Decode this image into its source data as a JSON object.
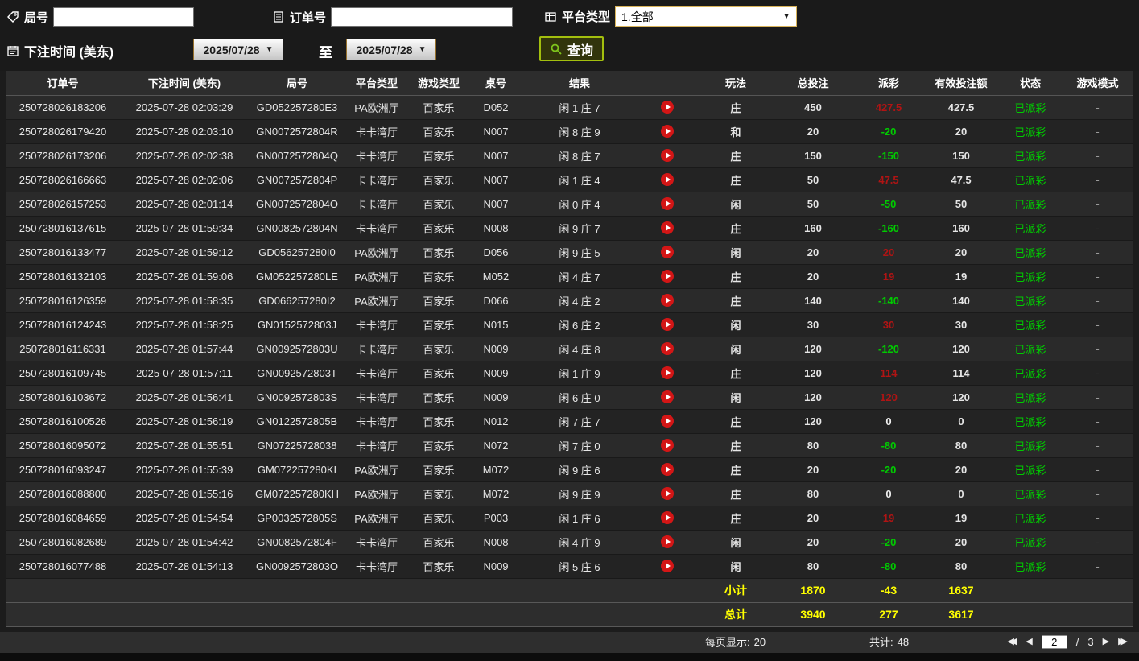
{
  "filters": {
    "game_no": {
      "label": "局号",
      "value": ""
    },
    "order_no": {
      "label": "订单号",
      "value": ""
    },
    "platform": {
      "label": "平台类型",
      "selected": "1.全部"
    },
    "bet_time": {
      "label": "下注时间 (美东)",
      "from": "2025/07/28",
      "to": "2025/07/28",
      "to_word": "至"
    },
    "query": {
      "label": "查询"
    }
  },
  "table": {
    "headers": [
      "订单号",
      "下注时间 (美东)",
      "局号",
      "平台类型",
      "游戏类型",
      "桌号",
      "结果",
      "",
      "玩法",
      "总投注",
      "派彩",
      "有效投注额",
      "状态",
      "游戏模式"
    ],
    "rows": [
      {
        "order": "250728026183206",
        "time": "2025-07-28 02:03:29",
        "game_no": "GD052257280E3",
        "platform": "PA欧洲厅",
        "game_type": "百家乐",
        "table_no": "D052",
        "result": "闲 1 庄 7",
        "side": "庄",
        "total_bet": "450",
        "payout": "427.5",
        "payout_color": "red",
        "valid_bet": "427.5",
        "status": "已派彩",
        "mode": "-"
      },
      {
        "order": "250728026179420",
        "time": "2025-07-28 02:03:10",
        "game_no": "GN0072572804R",
        "platform": "卡卡湾厅",
        "game_type": "百家乐",
        "table_no": "N007",
        "result": "闲 8 庄 9",
        "side": "和",
        "total_bet": "20",
        "payout": "-20",
        "payout_color": "green",
        "valid_bet": "20",
        "status": "已派彩",
        "mode": "-"
      },
      {
        "order": "250728026173206",
        "time": "2025-07-28 02:02:38",
        "game_no": "GN0072572804Q",
        "platform": "卡卡湾厅",
        "game_type": "百家乐",
        "table_no": "N007",
        "result": "闲 8 庄 7",
        "side": "庄",
        "total_bet": "150",
        "payout": "-150",
        "payout_color": "green",
        "valid_bet": "150",
        "status": "已派彩",
        "mode": "-"
      },
      {
        "order": "250728026166663",
        "time": "2025-07-28 02:02:06",
        "game_no": "GN0072572804P",
        "platform": "卡卡湾厅",
        "game_type": "百家乐",
        "table_no": "N007",
        "result": "闲 1 庄 4",
        "side": "庄",
        "total_bet": "50",
        "payout": "47.5",
        "payout_color": "red",
        "valid_bet": "47.5",
        "status": "已派彩",
        "mode": "-"
      },
      {
        "order": "250728026157253",
        "time": "2025-07-28 02:01:14",
        "game_no": "GN0072572804O",
        "platform": "卡卡湾厅",
        "game_type": "百家乐",
        "table_no": "N007",
        "result": "闲 0 庄 4",
        "side": "闲",
        "total_bet": "50",
        "payout": "-50",
        "payout_color": "green",
        "valid_bet": "50",
        "status": "已派彩",
        "mode": "-"
      },
      {
        "order": "250728016137615",
        "time": "2025-07-28 01:59:34",
        "game_no": "GN0082572804N",
        "platform": "卡卡湾厅",
        "game_type": "百家乐",
        "table_no": "N008",
        "result": "闲 9 庄 7",
        "side": "庄",
        "total_bet": "160",
        "payout": "-160",
        "payout_color": "green",
        "valid_bet": "160",
        "status": "已派彩",
        "mode": "-"
      },
      {
        "order": "250728016133477",
        "time": "2025-07-28 01:59:12",
        "game_no": "GD056257280I0",
        "platform": "PA欧洲厅",
        "game_type": "百家乐",
        "table_no": "D056",
        "result": "闲 9 庄 5",
        "side": "闲",
        "total_bet": "20",
        "payout": "20",
        "payout_color": "red",
        "valid_bet": "20",
        "status": "已派彩",
        "mode": "-"
      },
      {
        "order": "250728016132103",
        "time": "2025-07-28 01:59:06",
        "game_no": "GM052257280LE",
        "platform": "PA欧洲厅",
        "game_type": "百家乐",
        "table_no": "M052",
        "result": "闲 4 庄 7",
        "side": "庄",
        "total_bet": "20",
        "payout": "19",
        "payout_color": "red",
        "valid_bet": "19",
        "status": "已派彩",
        "mode": "-"
      },
      {
        "order": "250728016126359",
        "time": "2025-07-28 01:58:35",
        "game_no": "GD066257280I2",
        "platform": "PA欧洲厅",
        "game_type": "百家乐",
        "table_no": "D066",
        "result": "闲 4 庄 2",
        "side": "庄",
        "total_bet": "140",
        "payout": "-140",
        "payout_color": "green",
        "valid_bet": "140",
        "status": "已派彩",
        "mode": "-"
      },
      {
        "order": "250728016124243",
        "time": "2025-07-28 01:58:25",
        "game_no": "GN0152572803J",
        "platform": "卡卡湾厅",
        "game_type": "百家乐",
        "table_no": "N015",
        "result": "闲 6 庄 2",
        "side": "闲",
        "total_bet": "30",
        "payout": "30",
        "payout_color": "red",
        "valid_bet": "30",
        "status": "已派彩",
        "mode": "-"
      },
      {
        "order": "250728016116331",
        "time": "2025-07-28 01:57:44",
        "game_no": "GN0092572803U",
        "platform": "卡卡湾厅",
        "game_type": "百家乐",
        "table_no": "N009",
        "result": "闲 4 庄 8",
        "side": "闲",
        "total_bet": "120",
        "payout": "-120",
        "payout_color": "green",
        "valid_bet": "120",
        "status": "已派彩",
        "mode": "-"
      },
      {
        "order": "250728016109745",
        "time": "2025-07-28 01:57:11",
        "game_no": "GN0092572803T",
        "platform": "卡卡湾厅",
        "game_type": "百家乐",
        "table_no": "N009",
        "result": "闲 1 庄 9",
        "side": "庄",
        "total_bet": "120",
        "payout": "114",
        "payout_color": "red",
        "valid_bet": "114",
        "status": "已派彩",
        "mode": "-"
      },
      {
        "order": "250728016103672",
        "time": "2025-07-28 01:56:41",
        "game_no": "GN0092572803S",
        "platform": "卡卡湾厅",
        "game_type": "百家乐",
        "table_no": "N009",
        "result": "闲 6 庄 0",
        "side": "闲",
        "total_bet": "120",
        "payout": "120",
        "payout_color": "red",
        "valid_bet": "120",
        "status": "已派彩",
        "mode": "-"
      },
      {
        "order": "250728016100526",
        "time": "2025-07-28 01:56:19",
        "game_no": "GN0122572805B",
        "platform": "卡卡湾厅",
        "game_type": "百家乐",
        "table_no": "N012",
        "result": "闲 7 庄 7",
        "side": "庄",
        "total_bet": "120",
        "payout": "0",
        "payout_color": "white",
        "valid_bet": "0",
        "status": "已派彩",
        "mode": "-"
      },
      {
        "order": "250728016095072",
        "time": "2025-07-28 01:55:51",
        "game_no": "GN07225728038",
        "platform": "卡卡湾厅",
        "game_type": "百家乐",
        "table_no": "N072",
        "result": "闲 7 庄 0",
        "side": "庄",
        "total_bet": "80",
        "payout": "-80",
        "payout_color": "green",
        "valid_bet": "80",
        "status": "已派彩",
        "mode": "-"
      },
      {
        "order": "250728016093247",
        "time": "2025-07-28 01:55:39",
        "game_no": "GM072257280KI",
        "platform": "PA欧洲厅",
        "game_type": "百家乐",
        "table_no": "M072",
        "result": "闲 9 庄 6",
        "side": "庄",
        "total_bet": "20",
        "payout": "-20",
        "payout_color": "green",
        "valid_bet": "20",
        "status": "已派彩",
        "mode": "-"
      },
      {
        "order": "250728016088800",
        "time": "2025-07-28 01:55:16",
        "game_no": "GM072257280KH",
        "platform": "PA欧洲厅",
        "game_type": "百家乐",
        "table_no": "M072",
        "result": "闲 9 庄 9",
        "side": "庄",
        "total_bet": "80",
        "payout": "0",
        "payout_color": "white",
        "valid_bet": "0",
        "status": "已派彩",
        "mode": "-"
      },
      {
        "order": "250728016084659",
        "time": "2025-07-28 01:54:54",
        "game_no": "GP0032572805S",
        "platform": "PA欧洲厅",
        "game_type": "百家乐",
        "table_no": "P003",
        "result": "闲 1 庄 6",
        "side": "庄",
        "total_bet": "20",
        "payout": "19",
        "payout_color": "red",
        "valid_bet": "19",
        "status": "已派彩",
        "mode": "-"
      },
      {
        "order": "250728016082689",
        "time": "2025-07-28 01:54:42",
        "game_no": "GN0082572804F",
        "platform": "卡卡湾厅",
        "game_type": "百家乐",
        "table_no": "N008",
        "result": "闲 4 庄 9",
        "side": "闲",
        "total_bet": "20",
        "payout": "-20",
        "payout_color": "green",
        "valid_bet": "20",
        "status": "已派彩",
        "mode": "-"
      },
      {
        "order": "250728016077488",
        "time": "2025-07-28 01:54:13",
        "game_no": "GN0092572803O",
        "platform": "卡卡湾厅",
        "game_type": "百家乐",
        "table_no": "N009",
        "result": "闲 5 庄 6",
        "side": "闲",
        "total_bet": "80",
        "payout": "-80",
        "payout_color": "green",
        "valid_bet": "80",
        "status": "已派彩",
        "mode": "-"
      }
    ],
    "subtotal": {
      "label": "小计",
      "total_bet": "1870",
      "payout": "-43",
      "valid_bet": "1637"
    },
    "grand_total": {
      "label": "总计",
      "total_bet": "3940",
      "payout": "277",
      "valid_bet": "3617"
    }
  },
  "footer": {
    "per_page_label": "每页显示:",
    "per_page_value": "20",
    "total_label": "共计:",
    "total_value": "48",
    "current_page": "2",
    "page_separator": "/",
    "total_pages": "3"
  }
}
